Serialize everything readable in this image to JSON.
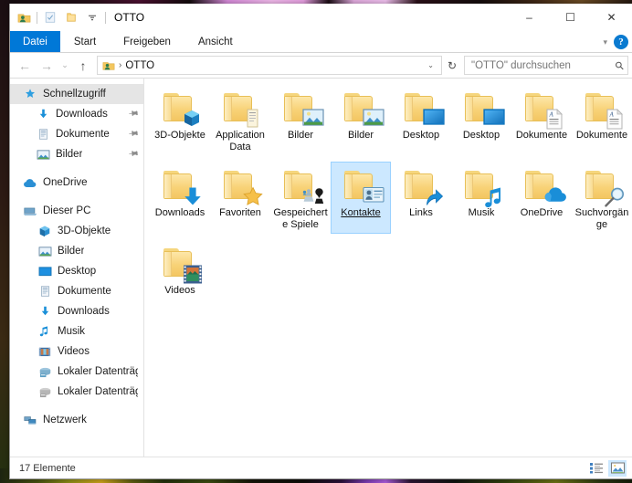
{
  "window": {
    "title": "OTTO",
    "quick_access_icons": [
      "user-folder-icon",
      "properties-icon",
      "new-folder-icon",
      "customize-dropdown-icon"
    ],
    "controls": {
      "minimize": "–",
      "maximize": "☐",
      "close": "✕"
    }
  },
  "ribbon": {
    "tabs": [
      {
        "label": "Datei",
        "active": true
      },
      {
        "label": "Start",
        "active": false
      },
      {
        "label": "Freigeben",
        "active": false
      },
      {
        "label": "Ansicht",
        "active": false
      }
    ],
    "collapse_icon": "chevron-down-icon",
    "help_label": "?",
    "accent_color": "#0078d7"
  },
  "address": {
    "back_icon": "←",
    "forward_icon": "→",
    "recent_icon": "⌄",
    "up_icon": "↑",
    "crumbs": [
      "OTTO"
    ],
    "separator": "›",
    "dropdown_icon": "⌄",
    "refresh_icon": "↻"
  },
  "search": {
    "placeholder": "\"OTTO\" durchsuchen",
    "icon": "search-icon"
  },
  "sidebar": {
    "groups": [
      {
        "items": [
          {
            "label": "Schnellzugriff",
            "icon": "star-pin-icon",
            "indent": 0,
            "selected": true,
            "pinned": false
          },
          {
            "label": "Downloads",
            "icon": "download-arrow-icon",
            "indent": 1,
            "selected": false,
            "pinned": true
          },
          {
            "label": "Dokumente",
            "icon": "document-icon",
            "indent": 1,
            "selected": false,
            "pinned": true
          },
          {
            "label": "Bilder",
            "icon": "picture-icon",
            "indent": 1,
            "selected": false,
            "pinned": true
          }
        ]
      },
      {
        "items": [
          {
            "label": "OneDrive",
            "icon": "cloud-icon",
            "indent": 0,
            "selected": false,
            "pinned": false
          }
        ]
      },
      {
        "items": [
          {
            "label": "Dieser PC",
            "icon": "pc-icon",
            "indent": 0,
            "selected": false,
            "pinned": false
          },
          {
            "label": "3D-Objekte",
            "icon": "3d-object-icon",
            "indent": 2,
            "selected": false,
            "pinned": false
          },
          {
            "label": "Bilder",
            "icon": "picture-icon",
            "indent": 2,
            "selected": false,
            "pinned": false
          },
          {
            "label": "Desktop",
            "icon": "desktop-icon",
            "indent": 2,
            "selected": false,
            "pinned": false
          },
          {
            "label": "Dokumente",
            "icon": "document-icon",
            "indent": 2,
            "selected": false,
            "pinned": false
          },
          {
            "label": "Downloads",
            "icon": "download-arrow-icon",
            "indent": 2,
            "selected": false,
            "pinned": false
          },
          {
            "label": "Musik",
            "icon": "music-note-icon",
            "indent": 2,
            "selected": false,
            "pinned": false
          },
          {
            "label": "Videos",
            "icon": "video-film-icon",
            "indent": 2,
            "selected": false,
            "pinned": false
          },
          {
            "label": "Lokaler Datenträger",
            "icon": "local-disk-icon",
            "indent": 2,
            "selected": false,
            "pinned": false
          },
          {
            "label": "Lokaler Datenträger",
            "icon": "local-disk-gray-icon",
            "indent": 2,
            "selected": false,
            "pinned": false
          }
        ]
      },
      {
        "items": [
          {
            "label": "Netzwerk",
            "icon": "network-icon",
            "indent": 0,
            "selected": false,
            "pinned": false
          }
        ]
      }
    ]
  },
  "files": {
    "items": [
      {
        "name": "3D-Objekte",
        "icon": "folder-3d-object",
        "selected": false
      },
      {
        "name": "Application Data",
        "icon": "folder-shortcut-doc",
        "selected": false
      },
      {
        "name": "Bilder",
        "icon": "folder-pictures",
        "selected": false
      },
      {
        "name": "Bilder",
        "icon": "folder-pictures",
        "selected": false
      },
      {
        "name": "Desktop",
        "icon": "folder-desktop",
        "selected": false
      },
      {
        "name": "Desktop",
        "icon": "folder-desktop",
        "selected": false
      },
      {
        "name": "Dokumente",
        "icon": "folder-documents",
        "selected": false
      },
      {
        "name": "Dokumente",
        "icon": "folder-documents",
        "selected": false
      },
      {
        "name": "Downloads",
        "icon": "folder-downloads",
        "selected": false
      },
      {
        "name": "Favoriten",
        "icon": "folder-favorites",
        "selected": false
      },
      {
        "name": "Gespeicherte Spiele",
        "icon": "folder-saved-games",
        "selected": false
      },
      {
        "name": "Kontakte",
        "icon": "folder-contacts",
        "selected": true
      },
      {
        "name": "Links",
        "icon": "folder-links",
        "selected": false
      },
      {
        "name": "Musik",
        "icon": "folder-music",
        "selected": false
      },
      {
        "name": "OneDrive",
        "icon": "folder-onedrive",
        "selected": false
      },
      {
        "name": "Suchvorgänge",
        "icon": "folder-searches",
        "selected": false
      },
      {
        "name": "Videos",
        "icon": "folder-videos",
        "selected": false
      }
    ]
  },
  "statusbar": {
    "count_label": "17 Elemente",
    "view_details_icon": "details-view-icon",
    "view_largeicons_icon": "large-icons-view-icon",
    "active_view": "large-icons"
  }
}
